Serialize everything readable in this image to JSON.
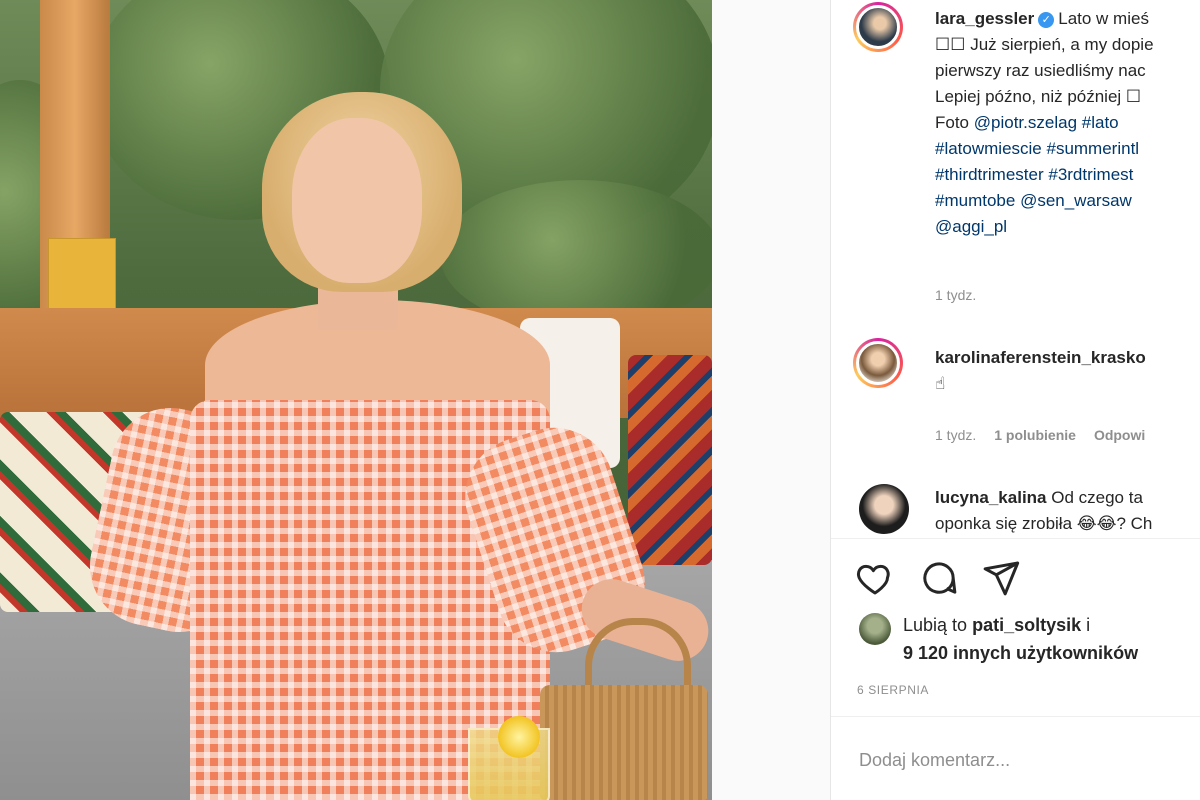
{
  "post": {
    "author": "lara_gessler",
    "caption_lines": [
      "Lato w mieś",
      "☐☐ Już sierpień, a my dopie",
      "pierwszy raz usiedliśmy nac",
      "Lepiej późno, niż później ☐"
    ],
    "foto_prefix": "Foto",
    "foto_mention": "@piotr.szelag",
    "foto_tag": "#lato",
    "tags_line1": "#latowmiescie #summerintl",
    "tags_line2": "#thirdtrimester #3rdtrimest",
    "tags_line3_tag": "#mumtobe",
    "tags_line3_mention": "@sen_warsaw",
    "tags_line4": "@aggi_pl",
    "time": "1 tydz."
  },
  "comments": [
    {
      "user": "karolinaferenstein_krasko",
      "text": "☝",
      "time": "1 tydz.",
      "likes": "1 polubienie",
      "reply": "Odpowi"
    },
    {
      "user": "lucyna_kalina",
      "text_line1": "Od czego ta",
      "text_line2": "oponka się zrobiła 😂😂? Ch"
    }
  ],
  "actions": {
    "like_icon": "heart-icon",
    "comment_icon": "comment-icon",
    "share_icon": "paper-plane-icon"
  },
  "likes": {
    "prefix": "Lubią to",
    "user": "pati_soltysik",
    "conj": "i",
    "count": "9 120 innych użytkowników"
  },
  "date": "6 SIERPNIA",
  "add_comment": {
    "placeholder": "Dodaj komentarz..."
  }
}
